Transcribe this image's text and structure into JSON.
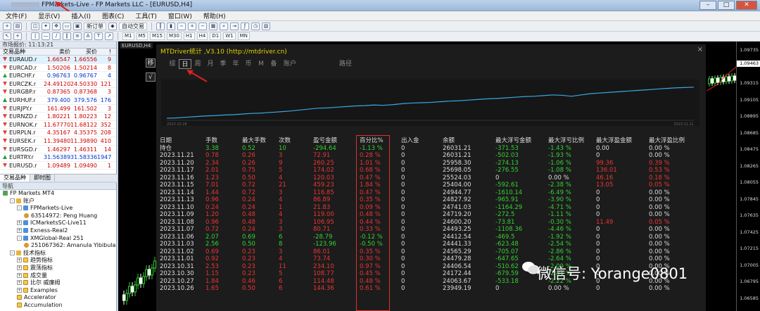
{
  "window": {
    "title": "FPMarkets-Live - FP Markets LLC - [EURUSD,H4]",
    "buttons": [
      "–",
      "□",
      "✕"
    ]
  },
  "menu": [
    "文件(F)",
    "显示(V)",
    "插入(I)",
    "图表(C)",
    "工具(T)",
    "窗口(W)",
    "帮助(H)"
  ],
  "toolbar": {
    "new_order": "新订单",
    "auto_trade": "自动交易",
    "timeframes": [
      "M1",
      "M5",
      "M15",
      "M30",
      "H1",
      "H4",
      "D1",
      "W1",
      "MN"
    ]
  },
  "market_watch": {
    "header": "市场报价: 11:13:21",
    "columns": [
      "交易品种",
      "卖价",
      "买价",
      "!"
    ],
    "rows": [
      {
        "sym": "EURAUD.r",
        "bid": "1.66547",
        "ask": "1.66556",
        "spr": "9",
        "dir": "dn"
      },
      {
        "sym": "EURCAD.r",
        "bid": "1.50206",
        "ask": "1.50214",
        "spr": "8",
        "dir": "dn"
      },
      {
        "sym": "EURCHF.r",
        "bid": "0.96763",
        "ask": "0.96767",
        "spr": "4",
        "dir": "up"
      },
      {
        "sym": "EURCZK.r",
        "bid": "24.49120",
        "ask": "24.50330",
        "spr": "121",
        "dir": "dn"
      },
      {
        "sym": "EURGBP.r",
        "bid": "0.87365",
        "ask": "0.87368",
        "spr": "3",
        "dir": "dn"
      },
      {
        "sym": "EURHUF.r",
        "bid": "379.400",
        "ask": "379.576",
        "spr": "176",
        "dir": "up"
      },
      {
        "sym": "EURJPY.r",
        "bid": "161.499",
        "ask": "161.502",
        "spr": "3",
        "dir": "dn"
      },
      {
        "sym": "EURNZD.r",
        "bid": "1.80221",
        "ask": "1.80223",
        "spr": "12",
        "dir": "dn"
      },
      {
        "sym": "EURNOK.r",
        "bid": "11.67770",
        "ask": "11.68122",
        "spr": "352",
        "dir": "dn"
      },
      {
        "sym": "EURPLN.r",
        "bid": "4.35167",
        "ask": "4.35375",
        "spr": "208",
        "dir": "dn"
      },
      {
        "sym": "EURSEK.r",
        "bid": "11.39480",
        "ask": "11.39890",
        "spr": "410",
        "dir": "dn"
      },
      {
        "sym": "EURSGD.r",
        "bid": "1.46297",
        "ask": "1.46311",
        "spr": "14",
        "dir": "dn"
      },
      {
        "sym": "EURTRY.r",
        "bid": "31.56389",
        "ask": "31.58336",
        "spr": "1947",
        "dir": "up"
      },
      {
        "sym": "EURUSD.r",
        "bid": "1.09489",
        "ask": "1.09490",
        "spr": "1",
        "dir": "dn"
      }
    ],
    "tabs": [
      "交易品种",
      "即时图"
    ]
  },
  "navigator": {
    "header": "导航",
    "items": [
      {
        "t": "FP Markets MT4",
        "lvl": 0,
        "ico": "root",
        "pm": ""
      },
      {
        "t": "账户",
        "lvl": 1,
        "ico": "acc",
        "pm": "-"
      },
      {
        "t": "FPMarkets-Live",
        "lvl": 2,
        "ico": "srv",
        "pm": "-"
      },
      {
        "t": "63514972: Peng Huang",
        "lvl": 3,
        "ico": "usr",
        "pm": ""
      },
      {
        "t": "ICMarketsSC-Live11",
        "lvl": 2,
        "ico": "srv",
        "pm": "+"
      },
      {
        "t": "Exness-Real2",
        "lvl": 2,
        "ico": "srv",
        "pm": "+"
      },
      {
        "t": "XMGlobal-Real 251",
        "lvl": 2,
        "ico": "srv",
        "pm": "-"
      },
      {
        "t": "251067362: Amanula Yibibula",
        "lvl": 3,
        "ico": "usr",
        "pm": ""
      },
      {
        "t": "技术指标",
        "lvl": 1,
        "ico": "acc",
        "pm": "-"
      },
      {
        "t": "趋势指标",
        "lvl": 2,
        "ico": "ind",
        "pm": "+"
      },
      {
        "t": "震荡指标",
        "lvl": 2,
        "ico": "ind",
        "pm": "+"
      },
      {
        "t": "成交量",
        "lvl": 2,
        "ico": "ind",
        "pm": "+"
      },
      {
        "t": "比尔 威廉姆",
        "lvl": 2,
        "ico": "ind",
        "pm": "+"
      },
      {
        "t": "Examples",
        "lvl": 2,
        "ico": "ind",
        "pm": "+"
      },
      {
        "t": "Accelerator",
        "lvl": 2,
        "ico": "ind",
        "pm": ""
      },
      {
        "t": "Accumulation",
        "lvl": 2,
        "ico": "ind",
        "pm": ""
      }
    ]
  },
  "chart": {
    "tab": "EURUSD,H4",
    "prices": [
      "1.09735",
      "1.09463",
      "1.09315",
      "1.09105",
      "1.08895",
      "1.08685",
      "1.08475",
      "1.08265",
      "1.08055",
      "1.07845",
      "1.07635",
      "1.07425",
      "1.07215",
      "1.07005",
      "1.06795",
      "1.06585"
    ],
    "current_price": "1.09463"
  },
  "panel": {
    "title": "MTDriver统计 ,V3.10 (http://mtdriver.cn)",
    "close": "×",
    "tabs": [
      "综",
      "日",
      "周",
      "月",
      "季",
      "年",
      "币",
      "M",
      "备",
      "账户"
    ],
    "active_tab": "日",
    "tab_extra": "路径",
    "side_buttons": [
      "移",
      "√"
    ],
    "graph_dates": [
      "2023.10.26",
      "2023.11.21"
    ],
    "equity": [
      0.02,
      0.03,
      0.05,
      0.07,
      0.09,
      0.1,
      0.12,
      0.13,
      0.15,
      0.17,
      0.18,
      0.2,
      0.22,
      0.24,
      0.27,
      0.3,
      0.33,
      0.34,
      0.36,
      0.38,
      0.4,
      0.41,
      0.43,
      0.42,
      0.44,
      0.47,
      0.49,
      0.5,
      0.51,
      0.53,
      0.55,
      0.56,
      0.58,
      0.6,
      0.62,
      0.63,
      0.65,
      0.67,
      0.69,
      0.7,
      0.72,
      0.74,
      0.73,
      0.7,
      0.74,
      0.78,
      0.8,
      0.82,
      0.84,
      0.86,
      0.88,
      0.9,
      0.92,
      0.94,
      0.96,
      0.97,
      0.98
    ],
    "headers": [
      "日期",
      "手数",
      "最大手数",
      "次数",
      "盈亏金额",
      "百分比%",
      "出入金",
      "余额",
      "最大浮亏金额",
      "最大浮亏比例",
      "最大浮盈金额",
      "最大浮盈比例"
    ],
    "rows": [
      {
        "c": [
          "持仓",
          "3.38",
          "0.52",
          "10",
          "-294.64",
          "-1.13 %",
          "0",
          "26031.21",
          "-371.53",
          "-1.43 %",
          "0.00",
          "0.00 %"
        ],
        "s": "g"
      },
      {
        "c": [
          "2023.11.21",
          "0.78",
          "0.26",
          "3",
          "72.91",
          "0.28 %",
          "0",
          "26031.21",
          "-502.03",
          "-1.93 %",
          "0",
          "0.00 %"
        ],
        "s": "r"
      },
      {
        "c": [
          "2023.11.20",
          "2.34",
          "0.26",
          "9",
          "260.25",
          "1.01 %",
          "0",
          "25958.30",
          "-274.13",
          "-1.06 %",
          "99.36",
          "0.39 %"
        ],
        "s": "r"
      },
      {
        "c": [
          "2023.11.17",
          "2.01",
          "0.75",
          "5",
          "174.02",
          "0.68 %",
          "0",
          "25698.05",
          "-276.55",
          "-1.08 %",
          "136.01",
          "0.53 %"
        ],
        "s": "r"
      },
      {
        "c": [
          "2023.11.16",
          "1.23",
          "0.50",
          "4",
          "120.03",
          "0.47 %",
          "0",
          "25524.03",
          "0",
          "0.00 %",
          "46.16",
          "0.18 %"
        ],
        "s": "r"
      },
      {
        "c": [
          "2023.11.15",
          "7.01",
          "0.72",
          "21",
          "459.23",
          "1.84 %",
          "0",
          "25404.00",
          "-592.61",
          "-2.38 %",
          "13.05",
          "0.05 %"
        ],
        "s": "r"
      },
      {
        "c": [
          "2023.11.14",
          "1.44",
          "0.72",
          "3",
          "116.85",
          "0.47 %",
          "0",
          "24944.77",
          "-1610.14",
          "-6.49 %",
          "0",
          "0.00 %"
        ],
        "s": "r"
      },
      {
        "c": [
          "2023.11.13",
          "0.96",
          "0.24",
          "4",
          "86.89",
          "0.35 %",
          "0",
          "24827.92",
          "-965.91",
          "-3.90 %",
          "0",
          "0.00 %"
        ],
        "s": "r"
      },
      {
        "c": [
          "2023.11.10",
          "0.24",
          "0.24",
          "1",
          "21.83",
          "0.09 %",
          "0",
          "24741.03",
          "-1164.29",
          "-4.71 %",
          "0",
          "0.00 %"
        ],
        "s": "r"
      },
      {
        "c": [
          "2023.11.09",
          "1.20",
          "0.48",
          "4",
          "119.00",
          "0.48 %",
          "0",
          "24719.20",
          "-272.5",
          "-1.11 %",
          "0",
          "0.00 %"
        ],
        "s": "r"
      },
      {
        "c": [
          "2023.11.08",
          "0.96",
          "0.48",
          "3",
          "106.95",
          "0.44 %",
          "0",
          "24600.20",
          "-73.81",
          "-0.30 %",
          "11.49",
          "0.05 %"
        ],
        "s": "r"
      },
      {
        "c": [
          "2023.11.07",
          "0.72",
          "0.24",
          "3",
          "80.71",
          "0.33 %",
          "0",
          "24493.25",
          "-1108.36",
          "-4.46 %",
          "0",
          "0.00 %"
        ],
        "s": "r"
      },
      {
        "c": [
          "2023.11.06",
          "2.07",
          "0.69",
          "6",
          "-28.79",
          "-0.12 %",
          "0",
          "24412.54",
          "-469.5",
          "-1.92 %",
          "0",
          "0.00 %"
        ],
        "s": "g"
      },
      {
        "c": [
          "2023.11.03",
          "2.56",
          "0.50",
          "8",
          "-123.96",
          "-0.50 %",
          "0",
          "24441.33",
          "-623.48",
          "-2.54 %",
          "0",
          "0.00 %"
        ],
        "s": "g"
      },
      {
        "c": [
          "2023.11.02",
          "0.69",
          "0.23",
          "3",
          "86.01",
          "0.35 %",
          "0",
          "24565.29",
          "-705.07",
          "-2.86 %",
          "0",
          "0.00 %"
        ],
        "s": "r"
      },
      {
        "c": [
          "2023.11.01",
          "0.92",
          "0.23",
          "4",
          "73.74",
          "0.30 %",
          "0",
          "24479.28",
          "-647.65",
          "-2.64 %",
          "0",
          "0.00 %"
        ],
        "s": "r"
      },
      {
        "c": [
          "2023.10.31",
          "2.53",
          "0.23",
          "11",
          "234.10",
          "0.97 %",
          "0",
          "24406.54",
          "-510.62",
          "-2.09 %",
          "0",
          "0.00 %"
        ],
        "s": "r"
      },
      {
        "c": [
          "2023.10.30",
          "1.15",
          "0.23",
          "5",
          "108.77",
          "0.45 %",
          "0",
          "24172.44",
          "-679.59",
          "-2.81 %",
          "0",
          "0.00 %"
        ],
        "s": "r"
      },
      {
        "c": [
          "2023.10.27",
          "1.84",
          "0.46",
          "6",
          "114.48",
          "0.48 %",
          "0",
          "24063.67",
          "-533.18",
          "-2.22 %",
          "0",
          "0.00 %"
        ],
        "s": "r"
      },
      {
        "c": [
          "2023.10.26",
          "1.65",
          "0.50",
          "6",
          "144.36",
          "0.61 %",
          "0",
          "23949.19",
          "0",
          "0.00 %",
          "0",
          "0.00 %"
        ],
        "s": "r"
      }
    ]
  },
  "watermark": "微信号: Yorange0801",
  "colors": {
    "profit": "#ee3434",
    "loss": "#35d235",
    "title": "#e6d200",
    "equity": "#38a8e0"
  }
}
